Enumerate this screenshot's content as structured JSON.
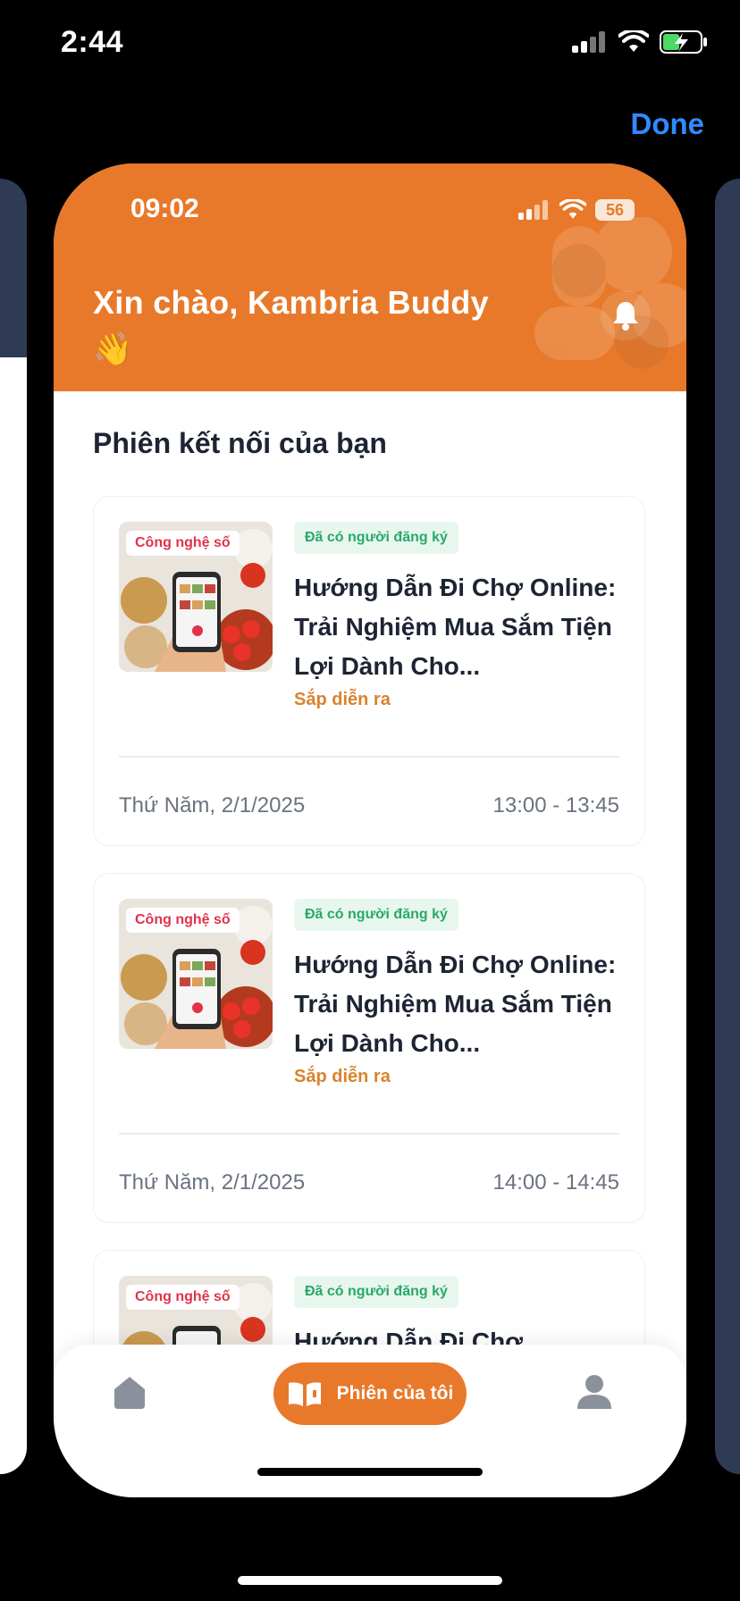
{
  "outer_status": {
    "time": "2:44"
  },
  "done_label": "Done",
  "inner_status": {
    "time": "09:02",
    "battery": "56"
  },
  "header": {
    "greeting": "Xin chào, Kambria Buddy 👋"
  },
  "section_title": "Phiên kết nối của bạn",
  "sessions": [
    {
      "category": "Công nghệ số",
      "status": "Đã có người đăng ký",
      "title": "Hướng Dẫn Đi Chợ Online: Trải Nghiệm Mua Sắm Tiện Lợi Dành Cho...",
      "state": "Sắp diễn ra",
      "date": "Thứ Năm, 2/1/2025",
      "time": "13:00 - 13:45"
    },
    {
      "category": "Công nghệ số",
      "status": "Đã có người đăng ký",
      "title": "Hướng Dẫn Đi Chợ Online: Trải Nghiệm Mua Sắm Tiện Lợi Dành Cho...",
      "state": "Sắp diễn ra",
      "date": "Thứ Năm, 2/1/2025",
      "time": "14:00 - 14:45"
    },
    {
      "category": "Công nghệ số",
      "status": "Đã có người đăng ký",
      "title": "Hướng Dẫn Đi Chợ"
    }
  ],
  "bottom_nav": {
    "active_label": "Phiên của tôi",
    "icons": [
      "home-icon",
      "book-icon",
      "profile-icon"
    ]
  },
  "colors": {
    "brand": "#e8792a",
    "status_green": "#2aa86a",
    "category_red": "#e0334a",
    "state_orange": "#d9832d",
    "done_blue": "#2f8bff"
  }
}
